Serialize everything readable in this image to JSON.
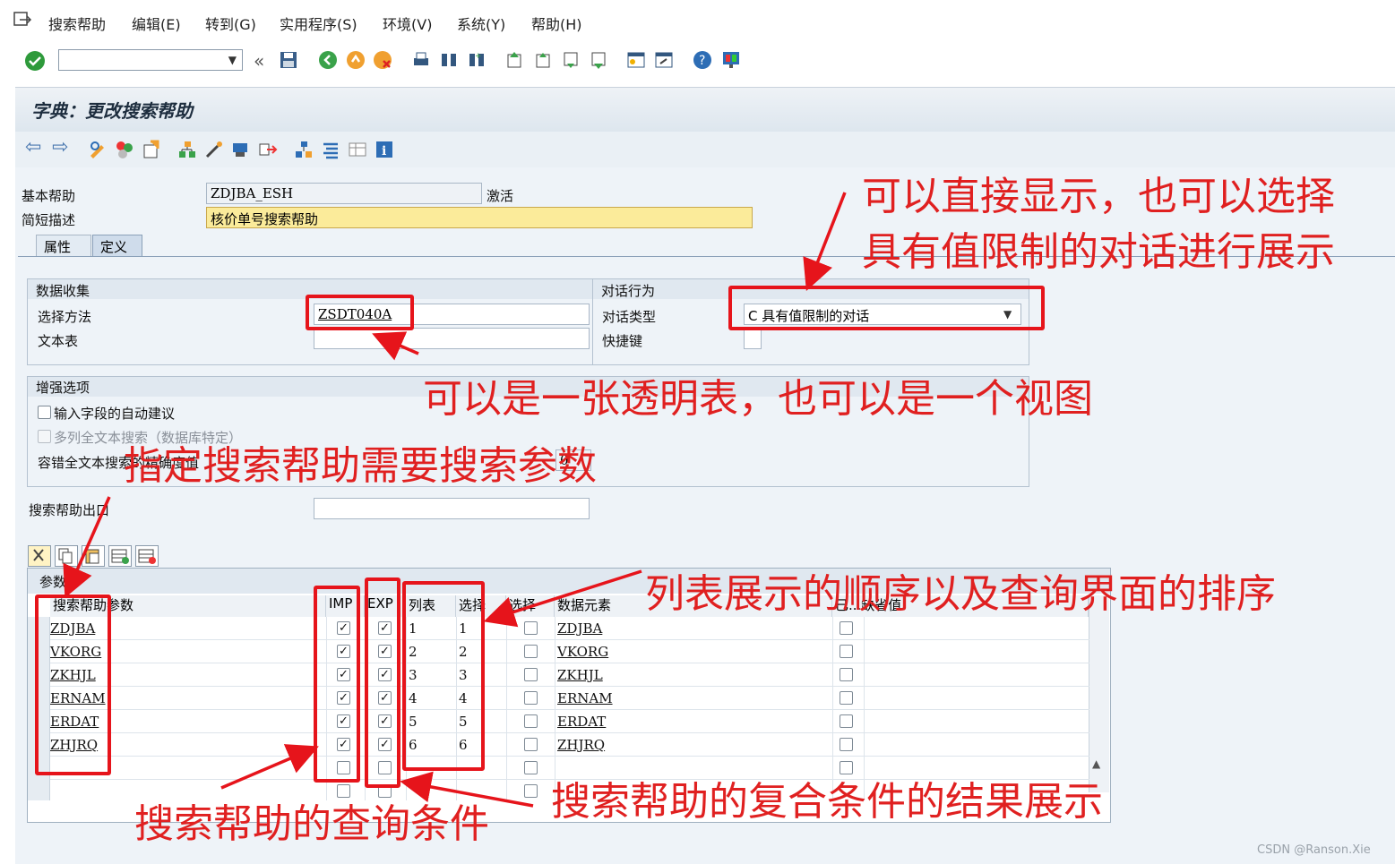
{
  "menu": {
    "items": [
      "搜索帮助",
      "编辑(E)",
      "转到(G)",
      "实用程序(S)",
      "环境(V)",
      "系统(Y)",
      "帮助(H)"
    ]
  },
  "page": {
    "title": "字典：更改搜索帮助"
  },
  "header": {
    "basic_help_label": "基本帮助",
    "basic_help_value": "ZDJBA_ESH",
    "status": "激活",
    "short_desc_label": "简短描述",
    "short_desc_value": "核价单号搜索帮助"
  },
  "tabs": [
    "属性",
    "定义"
  ],
  "data_collection": {
    "title": "数据收集",
    "method_label": "选择方法",
    "method_value": "ZSDT040A",
    "text_table_label": "文本表"
  },
  "dialog_behavior": {
    "title": "对话行为",
    "type_label": "对话类型",
    "type_value": "C 具有值限制的对话",
    "hotkey_label": "快捷键"
  },
  "enhanced": {
    "title": "增强选项",
    "option1": "输入字段的自动建议",
    "option2": "多列全文本搜索（数据库特定）",
    "option3": "容错全文本搜索的精确度值",
    "option3_value": "0"
  },
  "exit": {
    "label": "搜索帮助出口"
  },
  "params": {
    "title": "参数",
    "headers": [
      "搜索帮助参数",
      "IMP",
      "EXP",
      "列表",
      "选择",
      "选择",
      "数据元素",
      "已...缺省值"
    ],
    "rows": [
      {
        "name": "ZDJBA",
        "list": "1",
        "sel": "1",
        "element": "ZDJBA"
      },
      {
        "name": "VKORG",
        "list": "2",
        "sel": "2",
        "element": "VKORG"
      },
      {
        "name": "ZKHJL",
        "list": "3",
        "sel": "3",
        "element": "ZKHJL"
      },
      {
        "name": "ERNAM",
        "list": "4",
        "sel": "4",
        "element": "ERNAM"
      },
      {
        "name": "ERDAT",
        "list": "5",
        "sel": "5",
        "element": "ERDAT"
      },
      {
        "name": "ZHJRQ",
        "list": "6",
        "sel": "6",
        "element": "ZHJRQ"
      }
    ]
  },
  "annotations": {
    "a1_line1": "可以直接显示，也可以选择",
    "a1_line2": "具有值限制的对话进行展示",
    "a2": "可以是一张透明表，也可以是一个视图",
    "a3": "指定搜索帮助需要搜索参数",
    "a4": "列表展示的顺序以及查询界面的排序",
    "a5": "搜索帮助的复合条件的结果展示",
    "a6": "搜索帮助的查询条件"
  },
  "footer": {
    "credit": "CSDN @Ranson.Xie"
  },
  "colors": {
    "annotation": "#e02020",
    "check_ok": "#2e9a3b",
    "link": "#111111"
  }
}
